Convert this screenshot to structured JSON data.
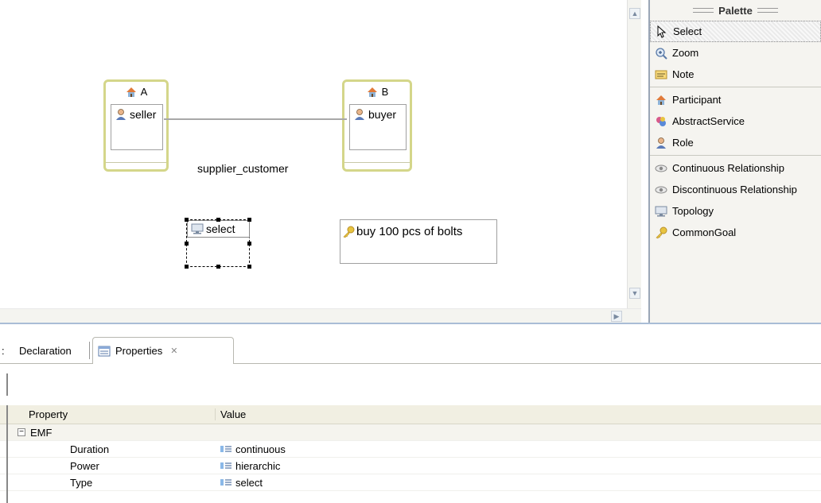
{
  "canvas": {
    "participant_a": {
      "name": "A",
      "role": "seller"
    },
    "participant_b": {
      "name": "B",
      "role": "buyer"
    },
    "relationship_label": "supplier_customer",
    "topology_label": "select",
    "goal_label": "buy 100 pcs of bolts"
  },
  "palette": {
    "title": "Palette",
    "items": [
      {
        "label": "Select",
        "icon": "arrow-cursor-icon"
      },
      {
        "label": "Zoom",
        "icon": "zoom-icon"
      },
      {
        "label": "Note",
        "icon": "note-icon"
      },
      {
        "label": "Participant",
        "icon": "house-icon"
      },
      {
        "label": "AbstractService",
        "icon": "service-icon"
      },
      {
        "label": "Role",
        "icon": "person-icon"
      },
      {
        "label": "Continuous Relationship",
        "icon": "eye-icon"
      },
      {
        "label": "Discontinuous Relationship",
        "icon": "eye-icon"
      },
      {
        "label": "Topology",
        "icon": "monitor-icon"
      },
      {
        "label": "CommonGoal",
        "icon": "key-icon"
      }
    ]
  },
  "tabs": {
    "prev_tab_fragment": ":",
    "declaration": "Declaration",
    "properties": "Properties",
    "close_glyph": "✕"
  },
  "properties": {
    "header_property": "Property",
    "header_value": "Value",
    "group": "EMF",
    "expander": "−",
    "rows": [
      {
        "name": "Duration",
        "value": "continuous"
      },
      {
        "name": "Power",
        "value": "hierarchic"
      },
      {
        "name": "Type",
        "value": "select"
      }
    ]
  },
  "colors": {
    "participant_border": "#d4d68a",
    "divider": "#a9bdd6",
    "palette_border": "#9aa6b6"
  }
}
